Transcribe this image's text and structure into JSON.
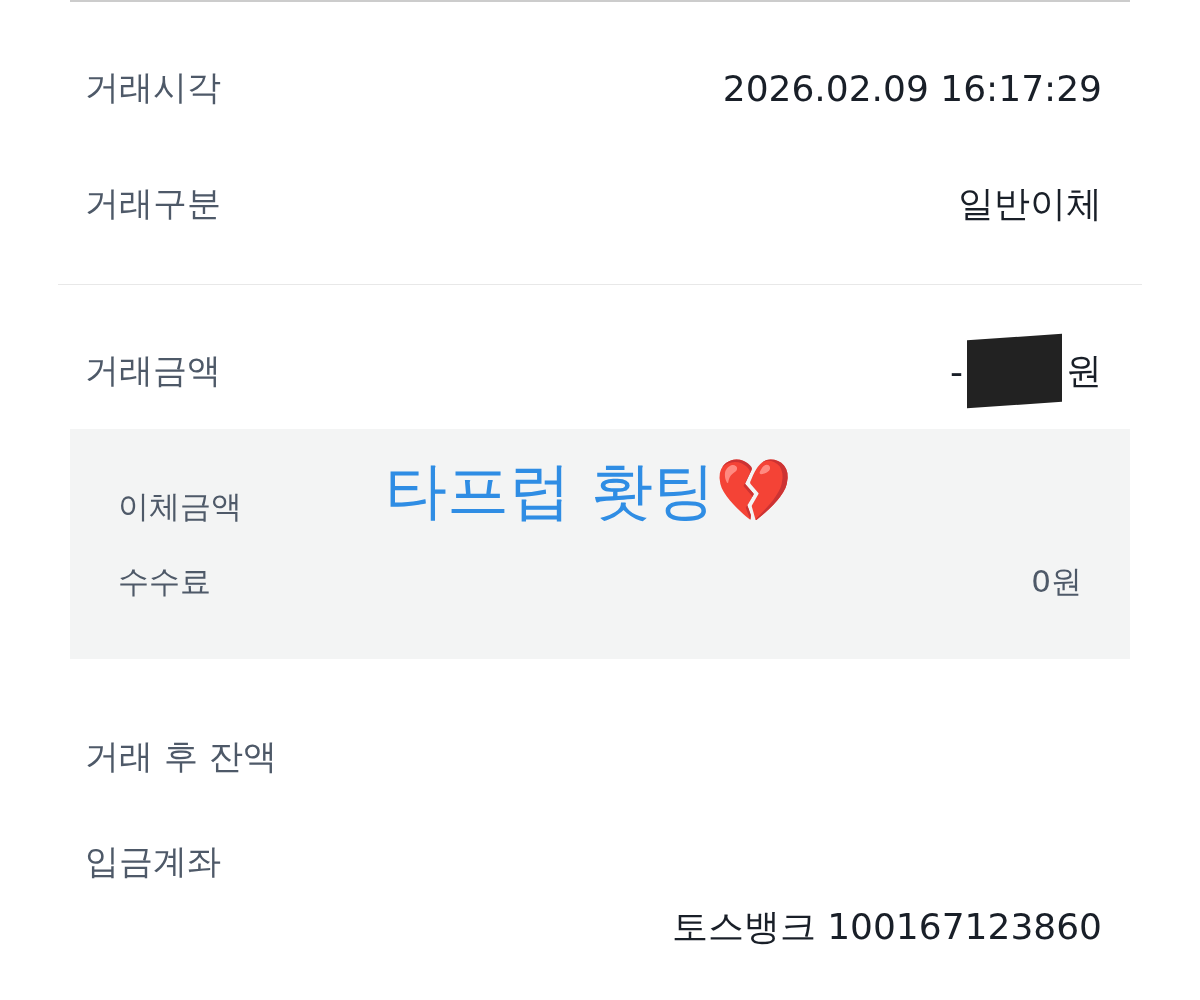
{
  "sections": [
    {
      "kind": "plain",
      "rows": [
        {
          "label": "거래시각",
          "value": "2026.02.09 16:17:29"
        },
        {
          "label": "거래구분",
          "value": "일반이체"
        }
      ]
    },
    {
      "kind": "amount",
      "rows": [
        {
          "label": "거래금액",
          "value_prefix": "-",
          "value_suffix": "원",
          "redacted": true
        }
      ],
      "breakdown": [
        {
          "label": "이체금액"
        },
        {
          "label": "수수료",
          "value": "0원"
        }
      ]
    },
    {
      "kind": "plain",
      "rows": [
        {
          "label": "거래 후 잔액"
        },
        {
          "label": "입금계좌",
          "value": "토스뱅크 100167123860",
          "value_below": true
        }
      ]
    }
  ],
  "overlay_text": "타프럽 홧팅💔"
}
